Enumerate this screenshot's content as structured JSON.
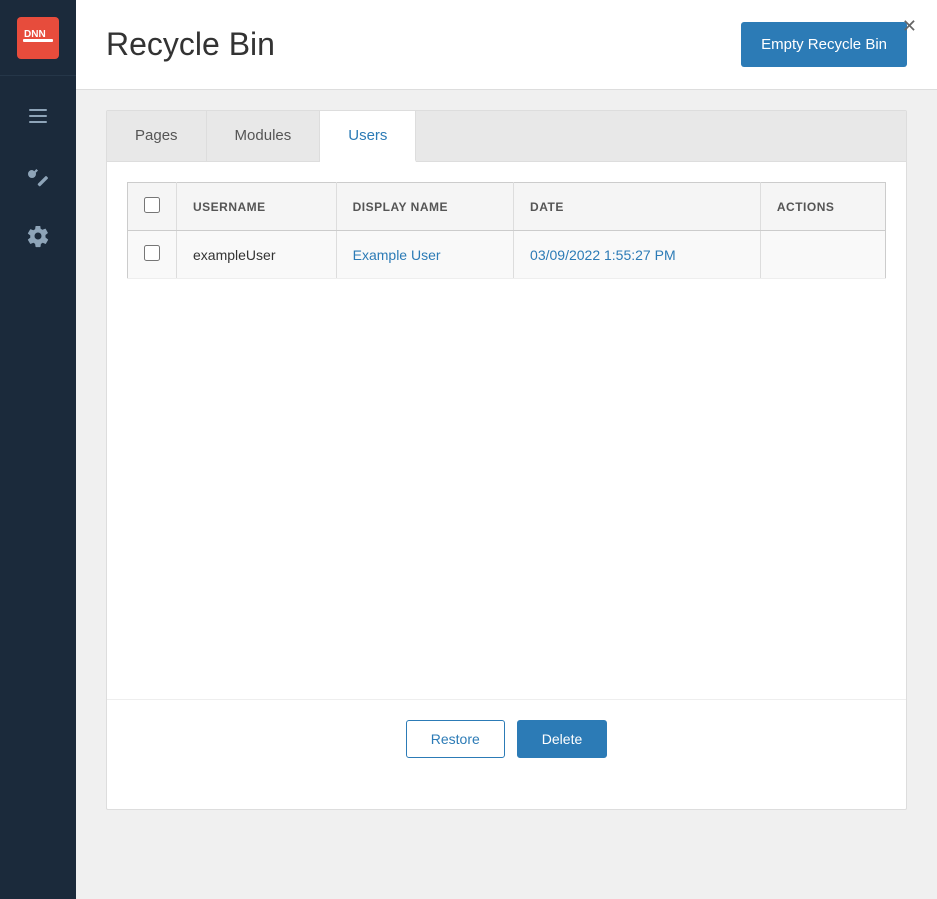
{
  "app": {
    "title": "DNN"
  },
  "header": {
    "title": "Recycle Bin",
    "empty_btn_label": "Empty Recycle Bin"
  },
  "tabs": [
    {
      "id": "pages",
      "label": "Pages",
      "active": false
    },
    {
      "id": "modules",
      "label": "Modules",
      "active": false
    },
    {
      "id": "users",
      "label": "Users",
      "active": true
    }
  ],
  "table": {
    "columns": [
      {
        "id": "checkbox",
        "label": ""
      },
      {
        "id": "username",
        "label": "USERNAME"
      },
      {
        "id": "display_name",
        "label": "DISPLAY NAME"
      },
      {
        "id": "date",
        "label": "DATE"
      },
      {
        "id": "actions",
        "label": "ACTIONS"
      }
    ],
    "rows": [
      {
        "username": "exampleUser",
        "display_name": "Example User",
        "date": "03/09/2022 1:55:27 PM",
        "actions": ""
      }
    ]
  },
  "actions": {
    "restore_label": "Restore",
    "delete_label": "Delete"
  },
  "sidebar": {
    "items": [
      {
        "id": "menu",
        "icon": "menu-icon"
      },
      {
        "id": "wrench",
        "icon": "wrench-icon"
      },
      {
        "id": "gear",
        "icon": "gear-icon"
      }
    ]
  }
}
